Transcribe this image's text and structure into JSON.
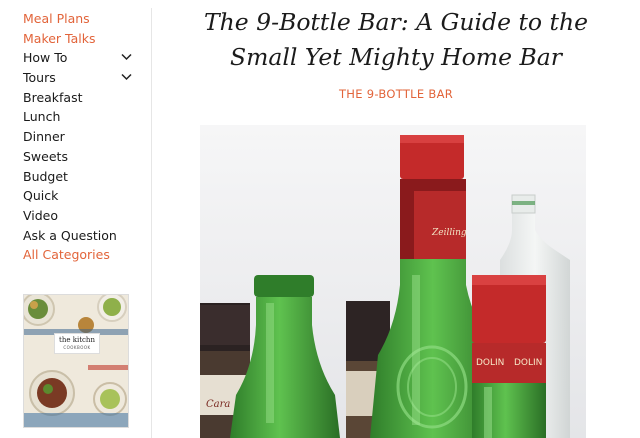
{
  "sidebar": {
    "items": [
      {
        "label": "Meal Plans",
        "accent": true
      },
      {
        "label": "Maker Talks",
        "accent": true
      },
      {
        "label": "How To",
        "accent": false,
        "dropdown": true
      },
      {
        "label": "Tours",
        "accent": false,
        "dropdown": true
      },
      {
        "label": "Breakfast",
        "accent": false
      },
      {
        "label": "Lunch",
        "accent": false
      },
      {
        "label": "Dinner",
        "accent": false
      },
      {
        "label": "Sweets",
        "accent": false
      },
      {
        "label": "Budget",
        "accent": false
      },
      {
        "label": "Quick",
        "accent": false
      },
      {
        "label": "Video",
        "accent": false
      },
      {
        "label": "Ask a Question",
        "accent": false
      },
      {
        "label": "All Categories",
        "accent": true
      }
    ],
    "promo": {
      "title": "the kitchn",
      "subtitle": "COOKBOOK"
    }
  },
  "article": {
    "title_line1": "The 9-Bottle Bar: A Guide to the",
    "title_line2": "Small Yet Mighty Home Bar",
    "section": "THE 9-BOTTLE BAR"
  },
  "hero_image": {
    "description_icon": "bottles-photo",
    "label_texts": [
      "Zeilling",
      "DOLIN",
      "DOLIN",
      "Cara"
    ]
  },
  "colors": {
    "accent": "#e2643a",
    "text": "#1a1a1a",
    "bottle_green": "#3fa53a",
    "cap_red": "#c42a2a",
    "divider": "#e6e6e6"
  }
}
